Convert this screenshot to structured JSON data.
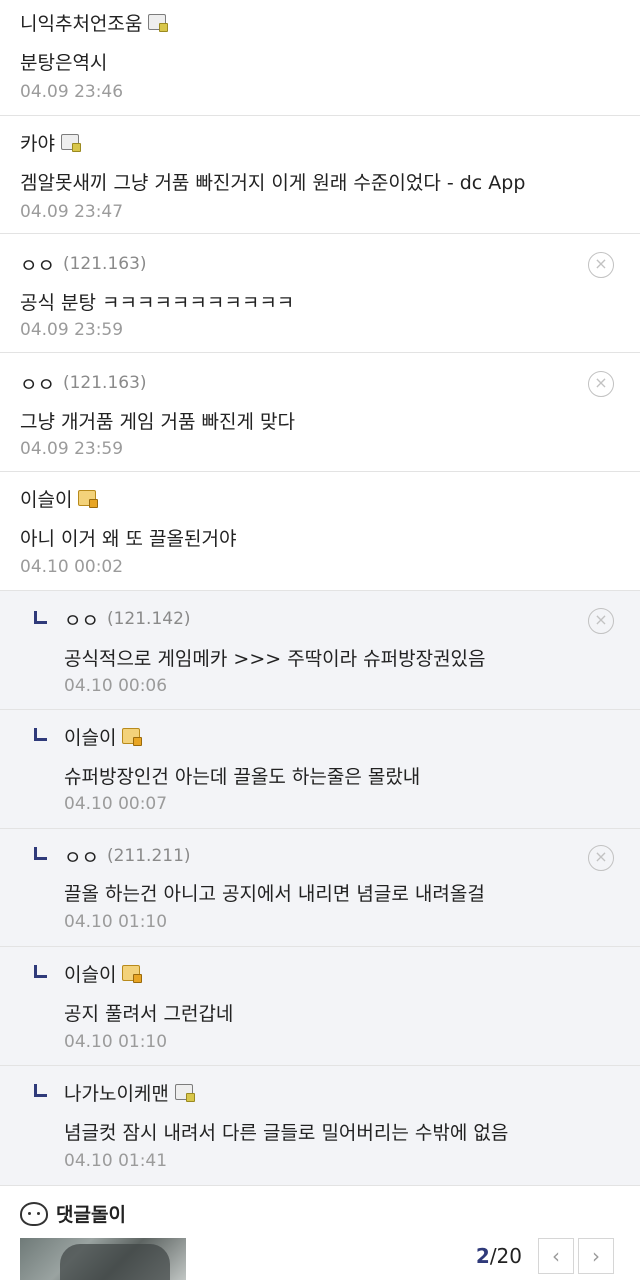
{
  "comments": [
    {
      "name": "니익추처언조움",
      "text": "분탕은역시",
      "time": "04.09 23:46"
    },
    {
      "name": "카야",
      "text": "겜알못새끼 그냥 거품 빠진거지 이게 원래 수준이었다 - dc App",
      "time": "04.09 23:47"
    },
    {
      "name": "ㅇㅇ",
      "ip": "(121.163)",
      "text": "공식 분탕 ㅋㅋㅋㅋㅋㅋㅋㅋㅋㅋㅋ",
      "time": "04.09 23:59"
    },
    {
      "name": "ㅇㅇ",
      "ip": "(121.163)",
      "text": "그냥 개거품 게임 거품 빠진게 맞다",
      "time": "04.09 23:59"
    },
    {
      "name": "이슬이",
      "text": "아니 이거 왜 또 끌올된거야",
      "time": "04.10 00:02"
    }
  ],
  "replies": [
    {
      "name": "ㅇㅇ",
      "ip": "(121.142)",
      "text": "공식적으로 게임메카 >>> 주딱이라 슈퍼방장권있음",
      "time": "04.10 00:06"
    },
    {
      "name": "이슬이",
      "text": "슈퍼방장인건 아는데 끌올도 하는줄은 몰랐내",
      "time": "04.10 00:07"
    },
    {
      "name": "ㅇㅇ",
      "ip": "(211.211)",
      "text": "끌올 하는건 아니고 공지에서 내리면 념글로 내려올걸",
      "time": "04.10 01:10"
    },
    {
      "name": "이슬이",
      "text": "공지 풀려서 그런갑네",
      "time": "04.10 01:10"
    },
    {
      "name": "나가노이케맨",
      "text": "념글컷 잠시 내려서 다른 글들로 밀어버리는 수밖에 없음",
      "time": "04.10 01:41"
    }
  ],
  "section": {
    "title": "댓글돌이"
  },
  "pager": {
    "current": "2",
    "total": "/20",
    "prev": "‹",
    "next": "›"
  },
  "icons": {
    "delete": "×"
  }
}
